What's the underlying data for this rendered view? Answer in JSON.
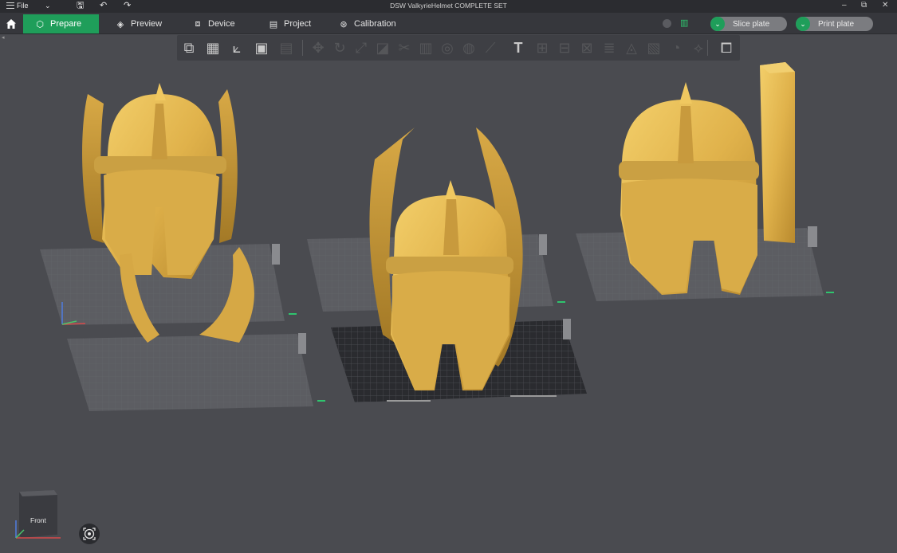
{
  "window": {
    "title": "DSW ValkyrieHelmet COMPLETE SET",
    "file_menu_label": "File"
  },
  "tabs": [
    {
      "label": "Prepare",
      "icon": "cube-icon",
      "active": true
    },
    {
      "label": "Preview",
      "icon": "layers-icon",
      "active": false
    },
    {
      "label": "Device",
      "icon": "device-icon",
      "active": false
    },
    {
      "label": "Project",
      "icon": "project-icon",
      "active": false
    },
    {
      "label": "Calibration",
      "icon": "calibration-icon",
      "active": false
    }
  ],
  "actions": {
    "slice_label": "Slice plate",
    "print_label": "Print plate"
  },
  "viewport": {
    "view_cube_label": "Front"
  },
  "colors": {
    "accent": "#1f9e5a",
    "background": "#4a4b50",
    "model": "#e2b44c",
    "plate": "#5c5d62",
    "plate_active": "#2a2b2f"
  }
}
